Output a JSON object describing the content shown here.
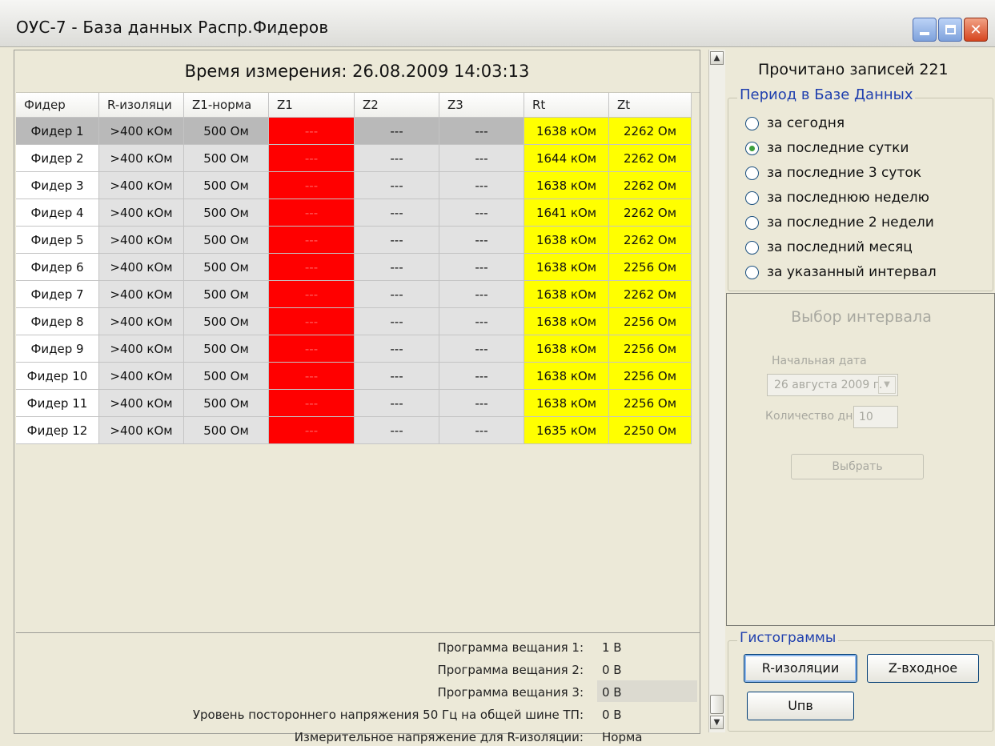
{
  "window": {
    "title": "ОУС-7 - База данных Распр.Фидеров"
  },
  "measurement": {
    "label": "Время измерения:",
    "datetime": "26.08.2009 14:03:13"
  },
  "table": {
    "columns": [
      "Фидер",
      "R-изоляци",
      "Z1-норма",
      "Z1",
      "Z2",
      "Z3",
      "Rt",
      "Zt"
    ],
    "rows": [
      [
        "Фидер 1",
        ">400 кОм",
        "500 Ом",
        "---",
        "---",
        "---",
        "1638 кОм",
        "2262 Ом"
      ],
      [
        "Фидер 2",
        ">400 кОм",
        "500 Ом",
        "---",
        "---",
        "---",
        "1644 кОм",
        "2262 Ом"
      ],
      [
        "Фидер 3",
        ">400 кОм",
        "500 Ом",
        "---",
        "---",
        "---",
        "1638 кОм",
        "2262 Ом"
      ],
      [
        "Фидер 4",
        ">400 кОм",
        "500 Ом",
        "---",
        "---",
        "---",
        "1641 кОм",
        "2262 Ом"
      ],
      [
        "Фидер 5",
        ">400 кОм",
        "500 Ом",
        "---",
        "---",
        "---",
        "1638 кОм",
        "2262 Ом"
      ],
      [
        "Фидер 6",
        ">400 кОм",
        "500 Ом",
        "---",
        "---",
        "---",
        "1638 кОм",
        "2256 Ом"
      ],
      [
        "Фидер 7",
        ">400 кОм",
        "500 Ом",
        "---",
        "---",
        "---",
        "1638 кОм",
        "2262 Ом"
      ],
      [
        "Фидер 8",
        ">400 кОм",
        "500 Ом",
        "---",
        "---",
        "---",
        "1638 кОм",
        "2256 Ом"
      ],
      [
        "Фидер 9",
        ">400 кОм",
        "500 Ом",
        "---",
        "---",
        "---",
        "1638 кОм",
        "2256 Ом"
      ],
      [
        "Фидер 10",
        ">400 кОм",
        "500 Ом",
        "---",
        "---",
        "---",
        "1638 кОм",
        "2256 Ом"
      ],
      [
        "Фидер 11",
        ">400 кОм",
        "500 Ом",
        "---",
        "---",
        "---",
        "1638 кОм",
        "2256 Ом"
      ],
      [
        "Фидер 12",
        ">400 кОм",
        "500 Ом",
        "---",
        "---",
        "---",
        "1635 кОм",
        "2250 Ом"
      ]
    ]
  },
  "info": [
    {
      "label": "Программа вещания 1:",
      "value": "1 В"
    },
    {
      "label": "Программа вещания 2:",
      "value": "0 В"
    },
    {
      "label": "Программа вещания 3:",
      "value": "0 В"
    },
    {
      "label": "Уровень постороннего напряжения 50 Гц на общей шине ТП:",
      "value": "0 В"
    },
    {
      "label": "Измерительное напряжение для R-изоляции:",
      "value": "Норма"
    }
  ],
  "records": {
    "text": "Прочитано записей 221"
  },
  "period": {
    "title": "Период в Базе Данных",
    "options": [
      "за сегодня",
      "за последние сутки",
      "за последние 3 суток",
      "за последнюю неделю",
      "за последние 2 недели",
      "за последний месяц",
      "за указанный интервал"
    ],
    "selected": "за последние сутки"
  },
  "interval": {
    "title": "Выбор интервала",
    "start_label": "Начальная дата",
    "start_value": "26  августа  2009 г.",
    "days_label": "Количество дней",
    "days_value": "10",
    "select_button": "Выбрать"
  },
  "histograms": {
    "title": "Гистограммы",
    "buttons": [
      "R-изоляции",
      "Z-входное",
      "Uпв"
    ]
  },
  "colors": {
    "z1_cell": "#ff0000",
    "rt_zt_cells": "#ffff00",
    "group_title": "#1f3fae"
  }
}
